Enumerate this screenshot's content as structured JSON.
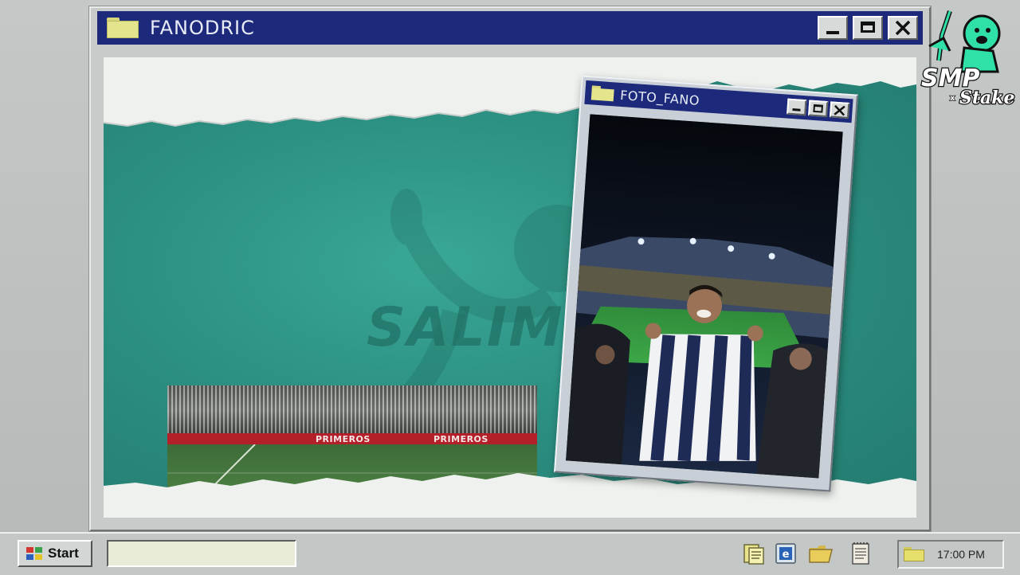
{
  "main_window": {
    "title": "FANODRIC",
    "buttons": {
      "minimize": "minimize",
      "maximize": "maximize",
      "close": "close"
    }
  },
  "background": {
    "watermark_text": "SALIMO"
  },
  "stadium_clip": {
    "ad_text_1": "PRIMEROS",
    "ad_text_2": "PRIMEROS"
  },
  "photo_window": {
    "title": "FOTO_FANO"
  },
  "logo": {
    "line1": "SMP",
    "x": "x",
    "line2": "Stake"
  },
  "taskbar": {
    "start_label": "Start",
    "search_value": "",
    "tray_icons": [
      "document-icon",
      "browser-icon",
      "folder-icon",
      "notepad-icon"
    ],
    "clock": "17:00 PM"
  },
  "colors": {
    "titlebar": "#1d2a7c",
    "accent_teal": "#2b8f81",
    "logo_green": "#2fe0a8"
  }
}
